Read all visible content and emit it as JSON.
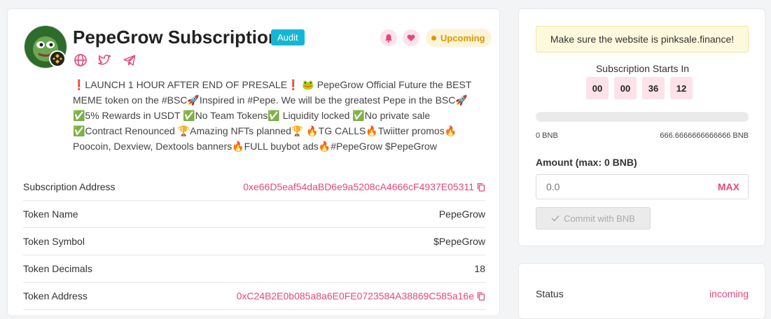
{
  "header": {
    "title": "PepeGrow Subscription",
    "audit_label": "Audit",
    "status_label": "Upcoming"
  },
  "colors": {
    "accent": "#e5487b",
    "audit": "#13b7d6",
    "upcoming": "#d99a00"
  },
  "icons": [
    "globe-icon",
    "twitter-icon",
    "telegram-icon",
    "bell-icon",
    "heart-icon",
    "copy-icon",
    "check-icon"
  ],
  "description": "❗LAUNCH 1 HOUR AFTER END OF PRESALE❗ 🐸 PepeGrow Official Future the BEST MEME token on the #BSC🚀Inspired in #Pepe. We will be the greatest Pepe in the BSC🚀 ✅5% Rewards in USDT ✅No Team Tokens✅ Liquidity locked ✅No private sale ✅Contract Renounced 🏆Amazing NFTs planned🏆 🔥TG CALLS🔥Twiitter promos🔥Poocoin, Dexview, Dextools banners🔥FULL buybot ads🔥#PepeGrow $PepeGrow",
  "details": [
    {
      "label": "Subscription Address",
      "value": "0xe66D5eaf54daBD6e9a5208cA4666cF4937E05311",
      "link": true
    },
    {
      "label": "Token Name",
      "value": "PepeGrow",
      "link": false
    },
    {
      "label": "Token Symbol",
      "value": "$PepeGrow",
      "link": false
    },
    {
      "label": "Token Decimals",
      "value": "18",
      "link": false
    },
    {
      "label": "Token Address",
      "value": "0xC24B2E0b085a8a6E0FE0723584A38869C585a16e",
      "link": true
    }
  ],
  "sidebar": {
    "notice": "Make sure the website is pinksale.finance!",
    "starts_label": "Subscription Starts In",
    "countdown": [
      "00",
      "00",
      "36",
      "12"
    ],
    "progress_fraction": 0,
    "range_min": "0 BNB",
    "range_max": "666.6666666666666 BNB",
    "amount_label": "Amount (max: 0 BNB)",
    "amount_placeholder": "0.0",
    "max_label": "MAX",
    "commit_label": "Commit with BNB",
    "status_label": "Status",
    "status_value": "incoming"
  }
}
